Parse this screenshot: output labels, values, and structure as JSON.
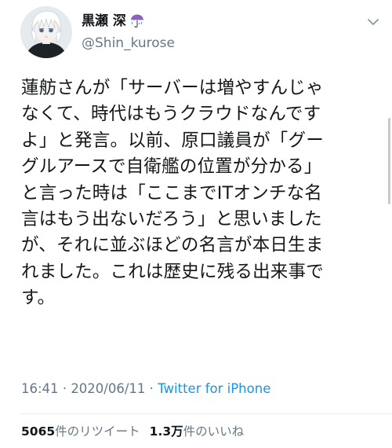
{
  "author": {
    "display_name": "黒瀬 深",
    "handle": "@Shin_kurose",
    "name_emoji": "umbrella-with-rain-icon"
  },
  "tweet": {
    "text": "蓮舫さんが「サーバーは増やすんじゃ\nなくて、時代はもうクラウドなんです\nよ」と発言。以前、原口議員が「グー\nグルアースで自衛艦の位置が分かる」\nと言った時は「ここまでITオンチな名\n言はもう出ないだろう」と思いました\nが、それに並ぶほどの名言が本日生ま\nれました。これは歴史に残る出来事で\nす。",
    "time": "16:41",
    "separator": "·",
    "date": "2020/06/11",
    "source": "Twitter for iPhone"
  },
  "stats": {
    "retweets_count": "5065",
    "retweets_label": "件のリツイート",
    "likes_count": "1.3万",
    "likes_label": "件のいいね"
  },
  "colors": {
    "secondary_text": "#657786",
    "link": "#1b95e0",
    "primary_text": "#14171a"
  }
}
